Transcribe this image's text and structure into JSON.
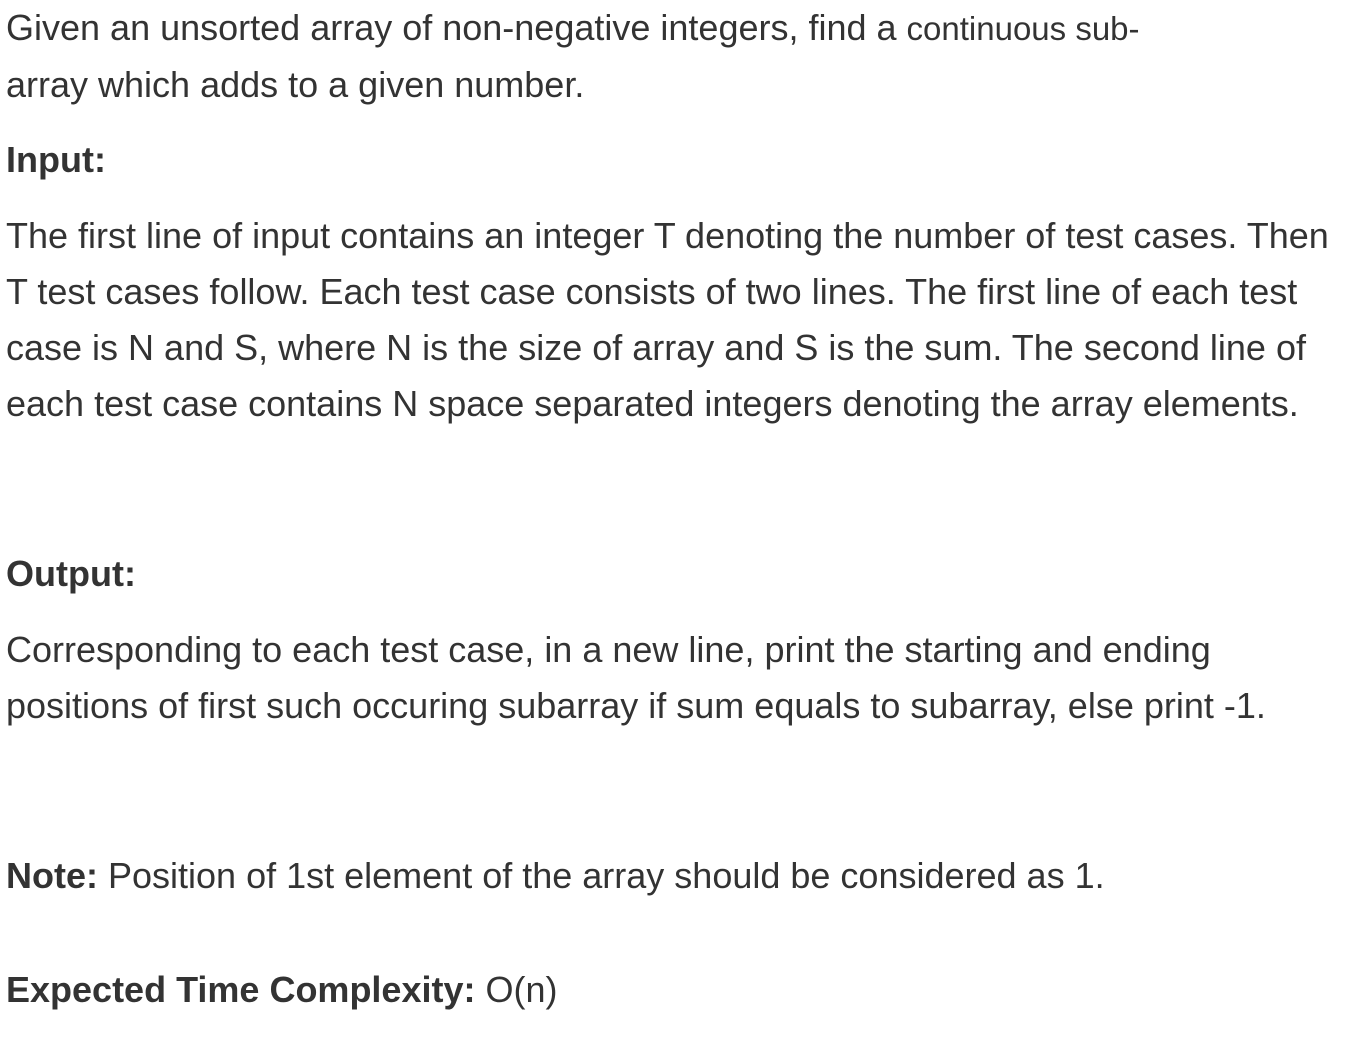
{
  "intro": {
    "part1": "Given an unsorted array of non-negative integers, find a ",
    "part2": "continuous sub-",
    "part3": "array which adds to a given number."
  },
  "input": {
    "heading": "Input:",
    "text": "The first line of input contains an integer T denoting the number of test cases. Then T test cases follow. Each test case consists of two lines. The first line of each test case is N and S, where N is the size of array and S is the sum. The second line of each test case contains N space separated integers denoting the array elements."
  },
  "output": {
    "heading": "Output:",
    "text": "Corresponding to each test case, in a new line, print the starting and ending positions of first such occuring subarray if sum equals to subarray, else print -1."
  },
  "note": {
    "label": "Note:",
    "text": " Position of 1st element of the array should be considered as 1."
  },
  "complexity": {
    "label": "Expected Time Complexity:",
    "text": " O(n)"
  }
}
